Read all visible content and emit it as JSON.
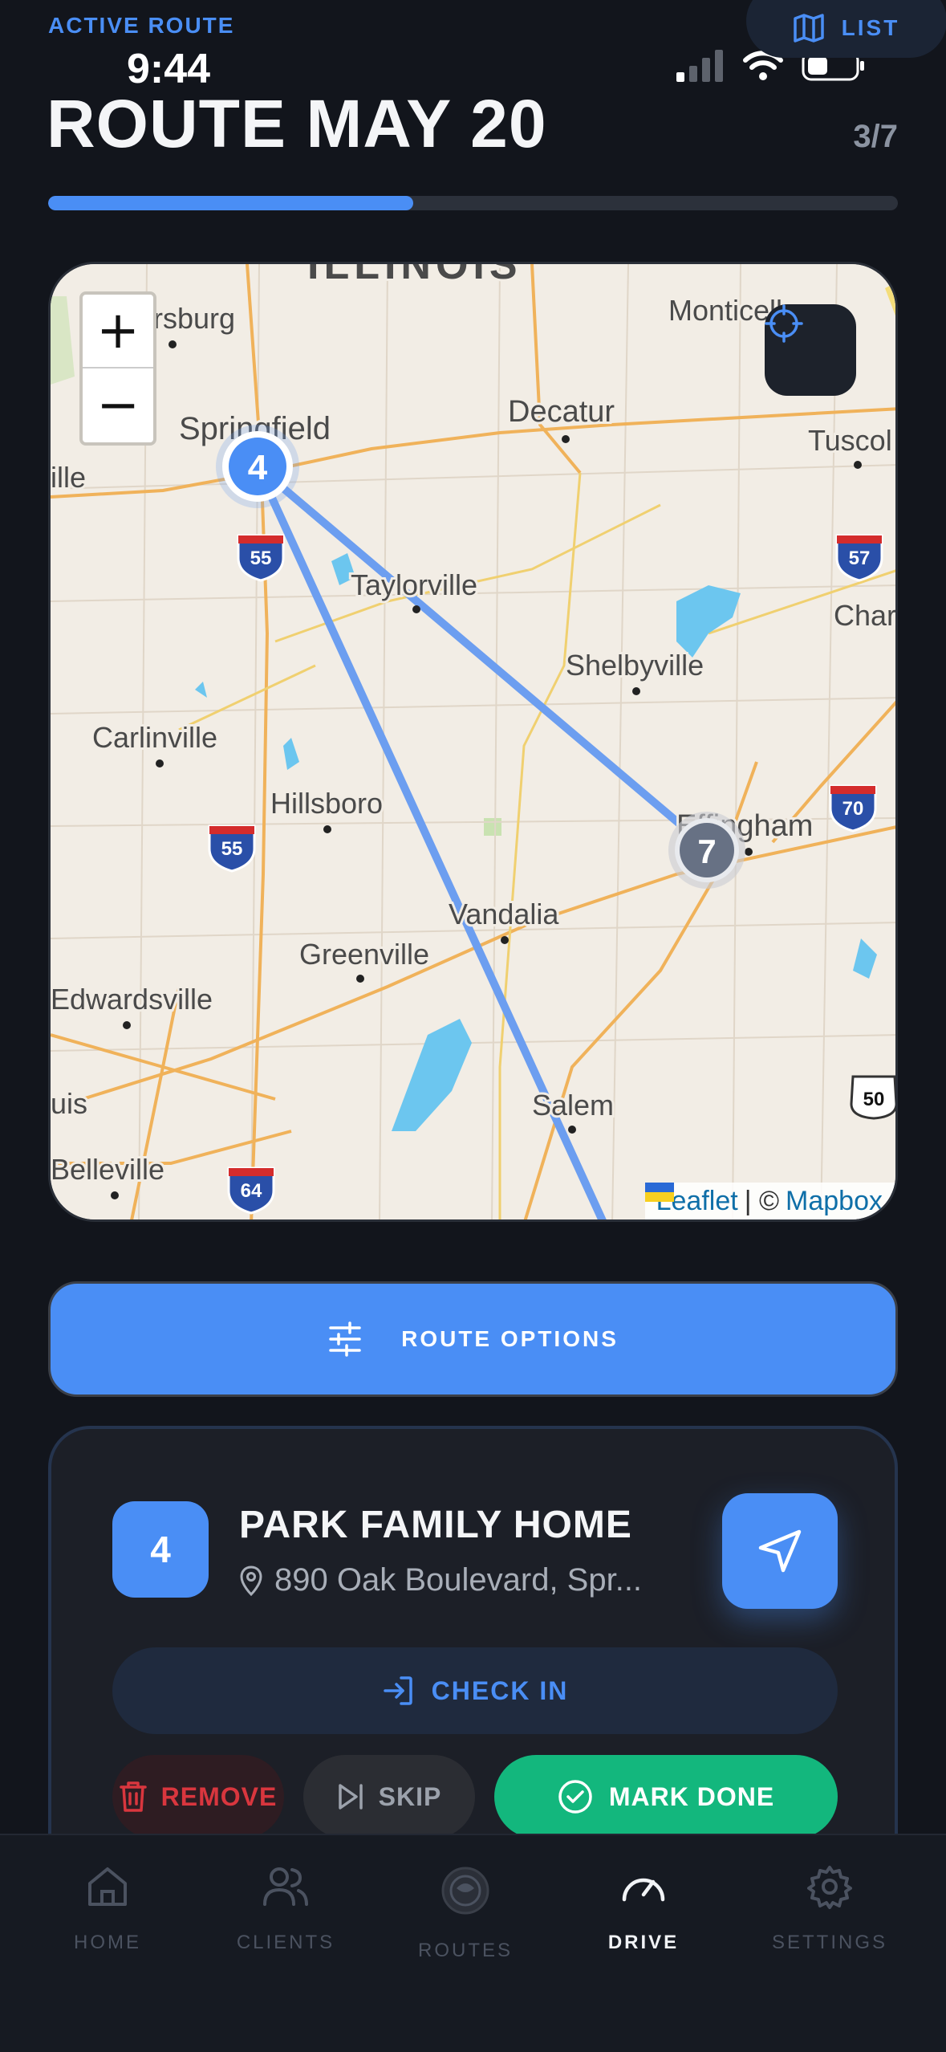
{
  "status_bar": {
    "time": "9:44"
  },
  "header": {
    "eyebrow": "ACTIVE ROUTE",
    "title": "ROUTE MAY 20",
    "count": "3/7",
    "list_label": "LIST",
    "progress": 0.43
  },
  "map": {
    "zoom_in": "+",
    "zoom_out": "−",
    "attribution_leaflet": "Leaflet",
    "attribution_sep": "| ©",
    "attribution_mapbox": "Mapbox",
    "markers": [
      "4",
      "7"
    ],
    "places": [
      "ILLINOIS",
      "ersburg",
      "Monticello",
      "Springfield",
      "Decatur",
      "Tuscol",
      "ille",
      "Taylorville",
      "Char",
      "Shelbyville",
      "Carlinville",
      "Effingham",
      "Hillsboro",
      "Vandalia",
      "Greenville",
      "Edwardsville",
      "uis",
      "Salem",
      "Belleville"
    ],
    "highways": [
      "55",
      "57",
      "70",
      "55",
      "50",
      "64"
    ]
  },
  "route_options": {
    "label": "ROUTE OPTIONS"
  },
  "stop": {
    "number": "4",
    "name": "PARK FAMILY HOME",
    "address": "890 Oak Boulevard, Spr...",
    "check_in": "CHECK IN",
    "remove": "REMOVE",
    "skip": "SKIP",
    "mark_done": "MARK DONE"
  },
  "tabs": [
    {
      "label": "HOME",
      "icon": "home-icon"
    },
    {
      "label": "CLIENTS",
      "icon": "users-icon"
    },
    {
      "label": "ROUTES",
      "icon": "routes-logo-icon"
    },
    {
      "label": "DRIVE",
      "icon": "speedometer-icon"
    },
    {
      "label": "SETTINGS",
      "icon": "gear-icon"
    }
  ],
  "colors": {
    "accent": "#4a8ef5",
    "success": "#13b77d",
    "danger": "#d9363e",
    "background": "#12151c"
  }
}
